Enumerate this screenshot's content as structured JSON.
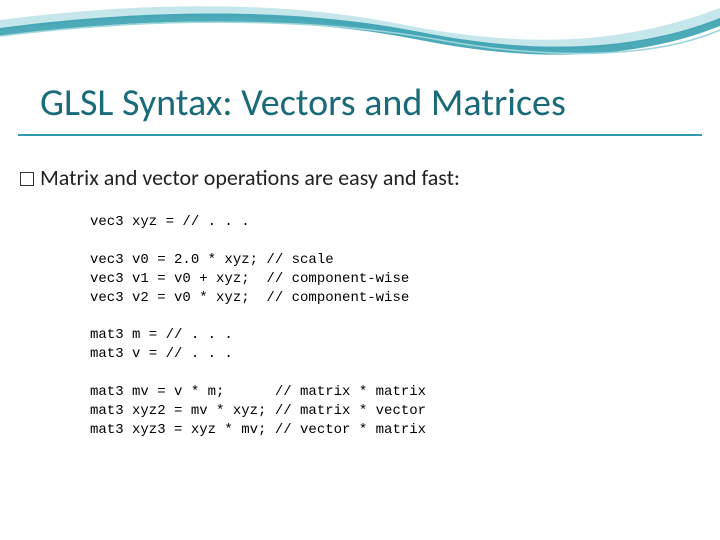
{
  "slide": {
    "title": "GLSL Syntax: Vectors and Matrices",
    "subtitle": "Matrix and vector operations are easy and fast:",
    "code": "vec3 xyz = // . . .\n\nvec3 v0 = 2.0 * xyz; // scale\nvec3 v1 = v0 + xyz;  // component-wise\nvec3 v2 = v0 * xyz;  // component-wise\n\nmat3 m = // . . .\nmat3 v = // . . .\n\nmat3 mv = v * m;      // matrix * matrix\nmat3 xyz2 = mv * xyz; // matrix * vector\nmat3 xyz3 = xyz * mv; // vector * matrix"
  }
}
